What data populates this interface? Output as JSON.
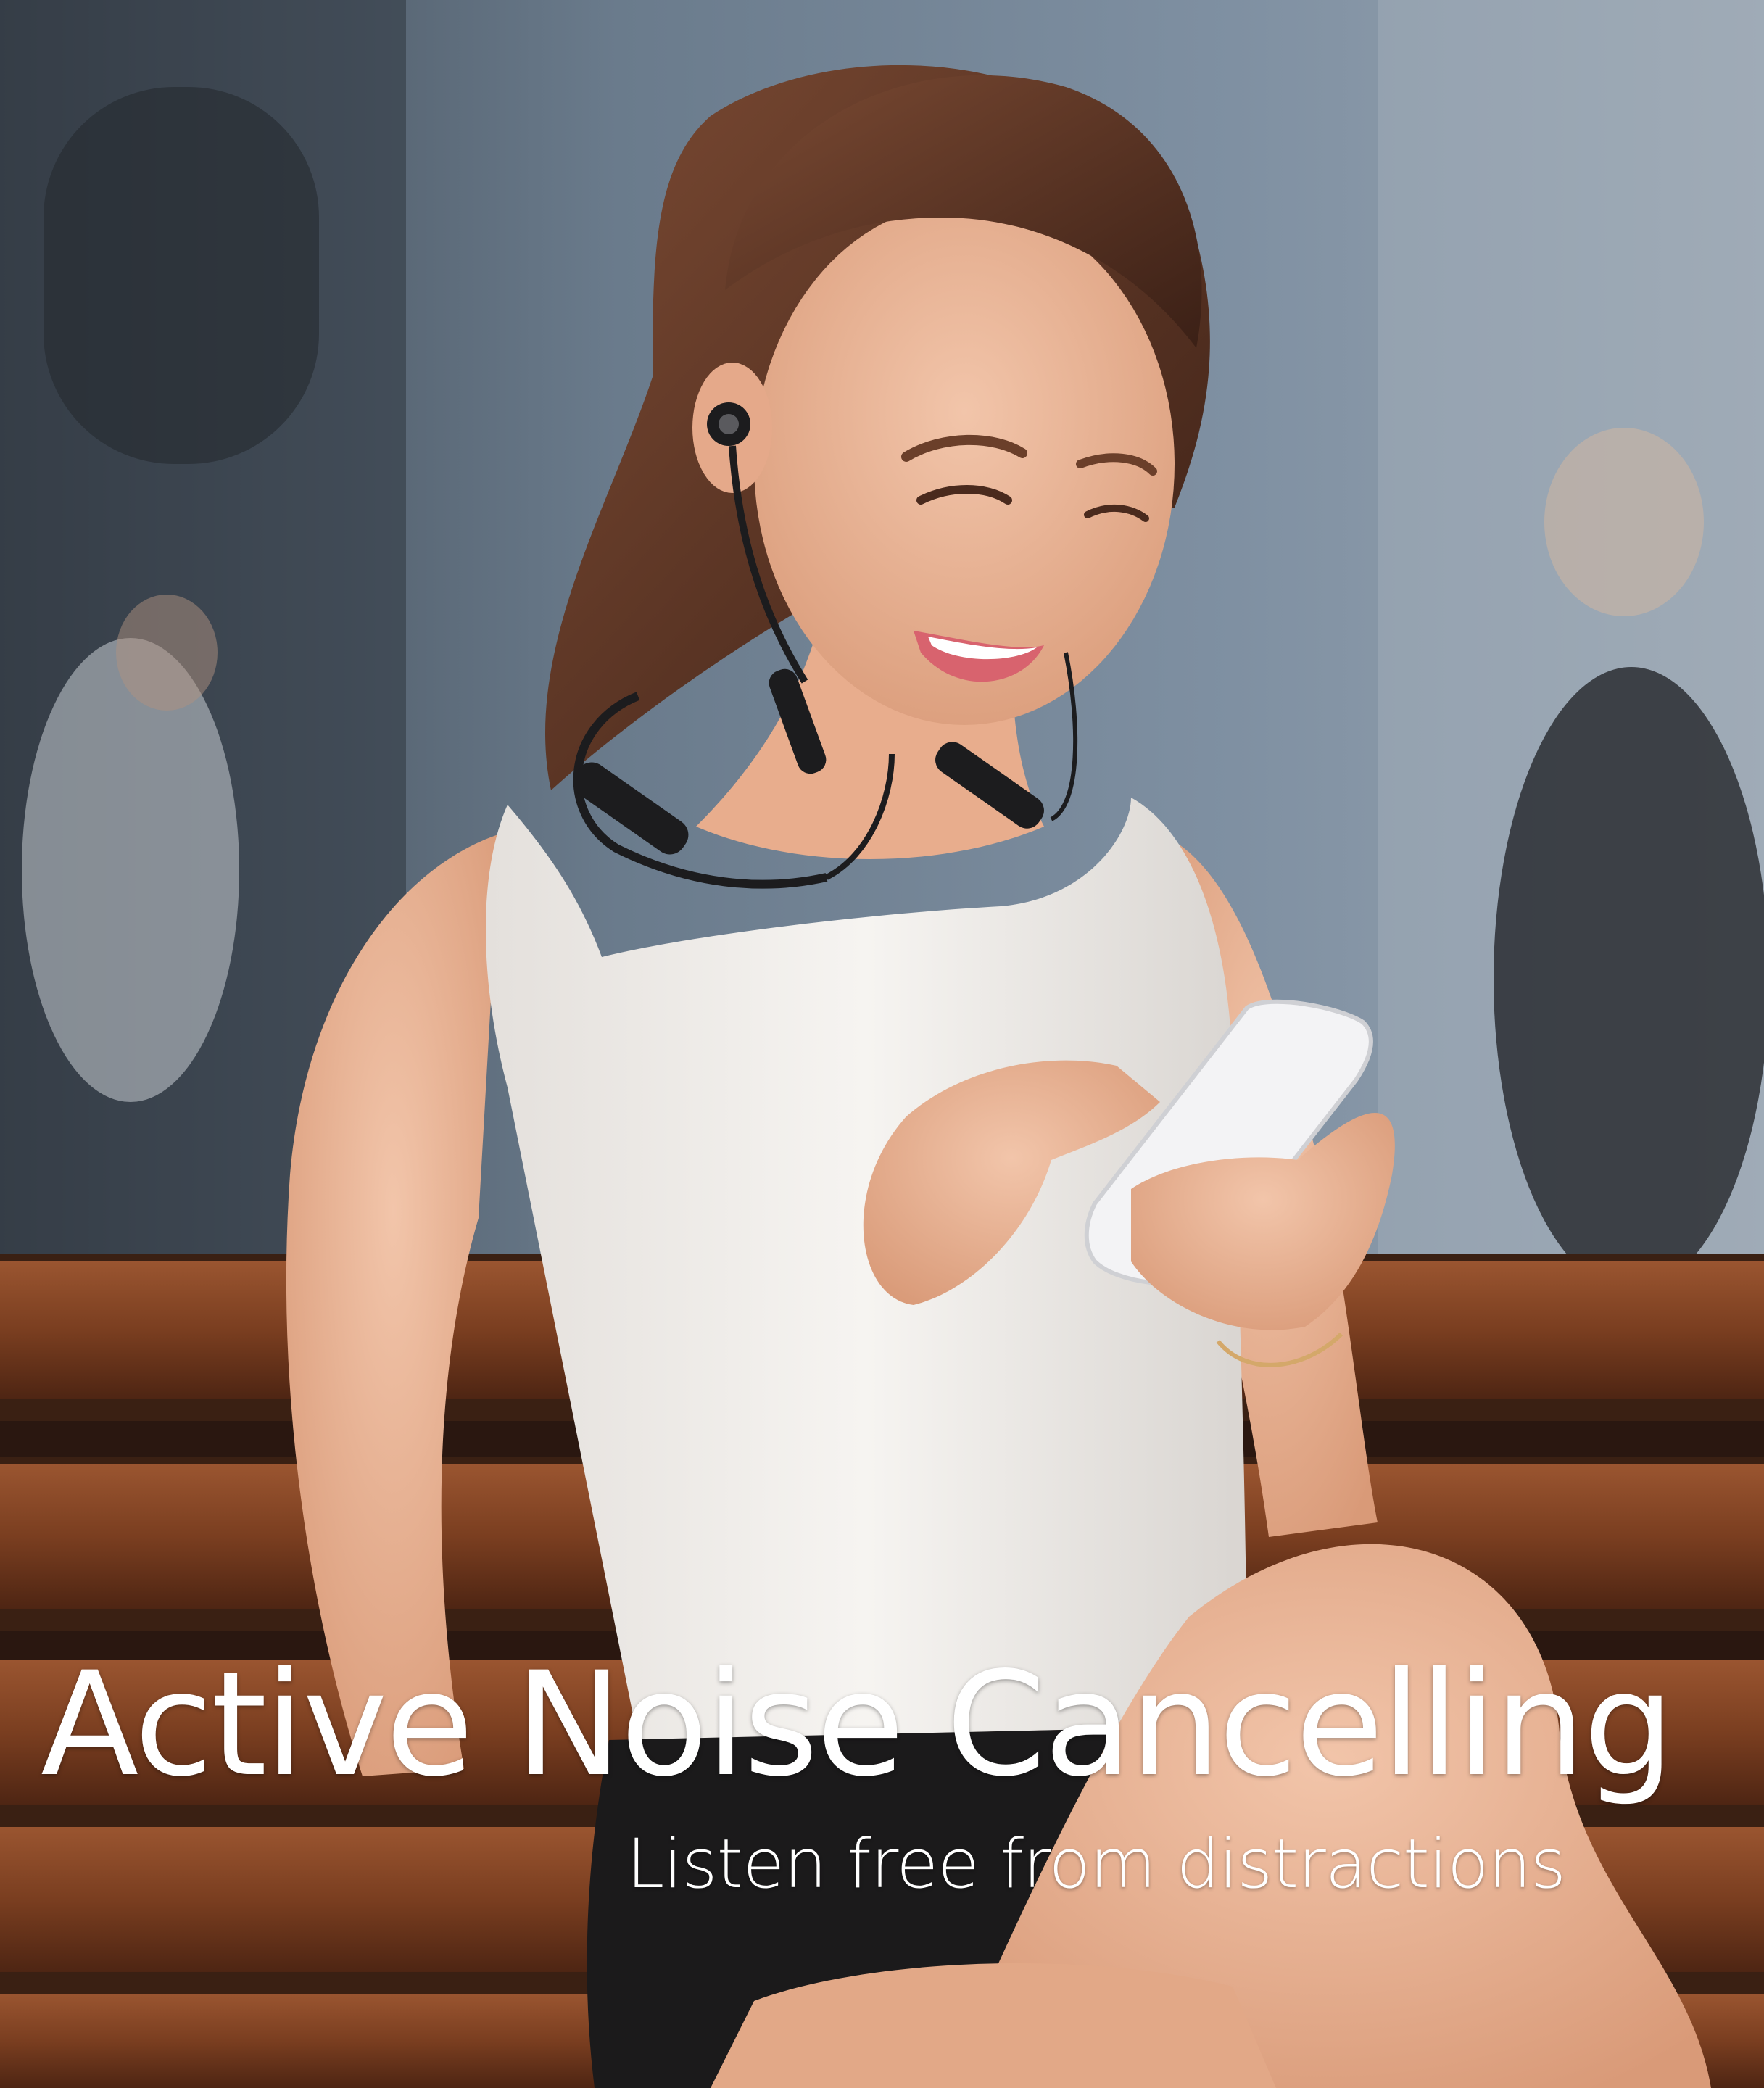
{
  "ad": {
    "headline": "Active Noise Cancelling",
    "tagline": "Listen free from distractions"
  },
  "colors": {
    "text": "#ffffff",
    "bench_wood": "#7a3f22",
    "tank_top": "#f1eeea",
    "shorts": "#1b1a1b",
    "skin": "#e7b293",
    "hair": "#5c3524",
    "background": "#6f7f90"
  },
  "icons": [
    "earphones-icon",
    "smartphone-icon"
  ]
}
